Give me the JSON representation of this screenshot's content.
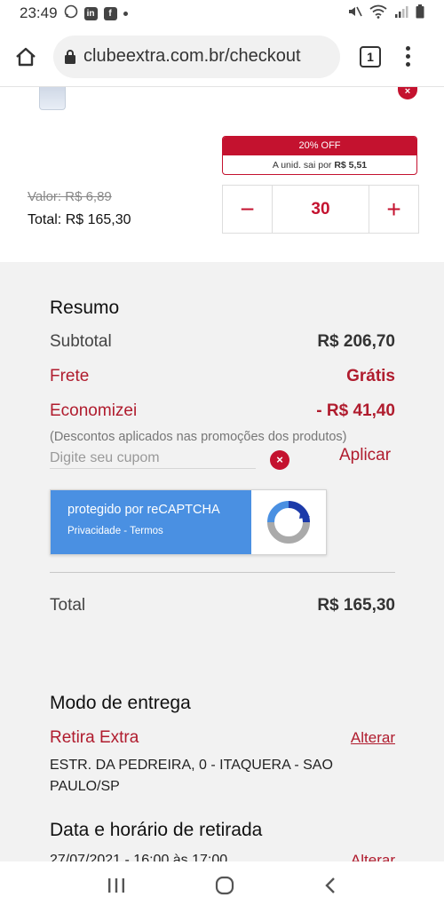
{
  "status_bar": {
    "time": "23:49",
    "notif_icons": [
      "whatsapp-icon",
      "linkedin-icon",
      "facebook-icon"
    ]
  },
  "browser": {
    "url": "clubeextra.com.br/checkout",
    "tab_count": "1"
  },
  "item": {
    "remove": "×",
    "promo_label": "20% OFF",
    "unit_text": "A unid. sai por",
    "unit_price": "R$ 5,51",
    "old_price": "Valor: R$ 6,89",
    "total": "Total: R$ 165,30",
    "qty_minus": "−",
    "qty": "30",
    "qty_plus": "+"
  },
  "summary": {
    "title": "Resumo",
    "subtotal_label": "Subtotal",
    "subtotal_value": "R$ 206,70",
    "frete_label": "Frete",
    "frete_value": "Grátis",
    "economizei_label": "Economizei",
    "economizei_value": "- R$ 41,40",
    "note": "(Descontos aplicados nas promoções dos produtos)",
    "coupon_placeholder": "Digite seu cupom",
    "coupon_clear": "×",
    "apply": "Aplicar",
    "recaptcha_title": "protegido por reCAPTCHA",
    "recaptcha_links": "Privacidade - Termos",
    "total_label": "Total",
    "total_value": "R$ 165,30"
  },
  "delivery": {
    "title": "Modo de entrega",
    "mode": "Retira Extra",
    "change": "Alterar",
    "address": "ESTR. DA PEDREIRA, 0 - ITAQUERA - SAO PAULO/SP"
  },
  "pickup": {
    "title": "Data e horário de retirada",
    "datetime": "27/07/2021 - 16:00 às 17:00",
    "change": "Alterar"
  },
  "colors": {
    "accent": "#c4122f",
    "recaptcha_blue": "#4a90e2"
  }
}
